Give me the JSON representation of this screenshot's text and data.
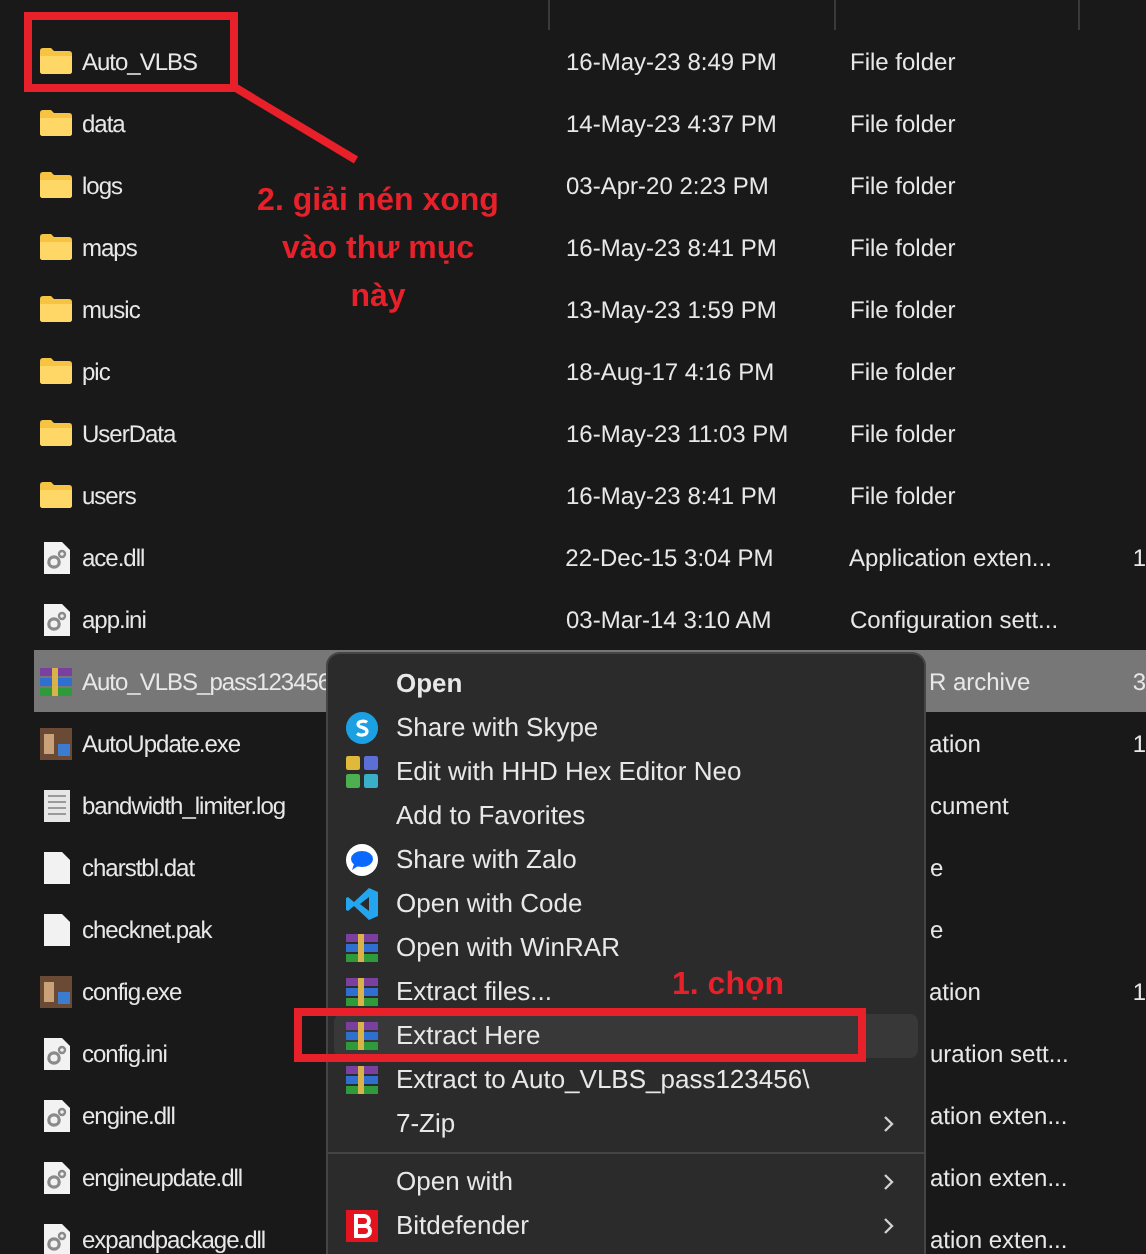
{
  "files": [
    {
      "kind": "folder",
      "name": "Auto_VLBS",
      "date": "16-May-23 8:49 PM",
      "type": "File folder",
      "selected": false
    },
    {
      "kind": "folder",
      "name": "data",
      "date": "14-May-23 4:37 PM",
      "type": "File folder",
      "selected": false
    },
    {
      "kind": "folder",
      "name": "logs",
      "date": "03-Apr-20 2:23 PM",
      "type": "File folder",
      "selected": false
    },
    {
      "kind": "folder",
      "name": "maps",
      "date": "16-May-23 8:41 PM",
      "type": "File folder",
      "selected": false
    },
    {
      "kind": "folder",
      "name": "music",
      "date": "13-May-23 1:59 PM",
      "type": "File folder",
      "selected": false
    },
    {
      "kind": "folder",
      "name": "pic",
      "date": "18-Aug-17 4:16 PM",
      "type": "File folder",
      "selected": false
    },
    {
      "kind": "folder",
      "name": "UserData",
      "date": "16-May-23 11:03 PM",
      "type": "File folder",
      "selected": false
    },
    {
      "kind": "folder",
      "name": "users",
      "date": "16-May-23 8:41 PM",
      "type": "File folder",
      "selected": false
    },
    {
      "kind": "settings",
      "name": "ace.dll",
      "date": "22-Dec-15 3:04 PM",
      "type": "Application exten...",
      "size": "1",
      "selected": false
    },
    {
      "kind": "settings",
      "name": "app.ini",
      "date": "03-Mar-14 3:10 AM",
      "type": "Configuration sett...",
      "selected": false
    },
    {
      "kind": "archive",
      "name": "Auto_VLBS_pass123456",
      "type": "R archive",
      "size": "3",
      "selected": true
    },
    {
      "kind": "program",
      "name": "AutoUpdate.exe",
      "type": "ation",
      "size": "1",
      "selected": false
    },
    {
      "kind": "text",
      "name": "bandwidth_limiter.log",
      "type": "cument",
      "selected": false
    },
    {
      "kind": "blank",
      "name": "charstbl.dat",
      "type": "e",
      "selected": false
    },
    {
      "kind": "blank",
      "name": "checknet.pak",
      "type": "e",
      "selected": false
    },
    {
      "kind": "program",
      "name": "config.exe",
      "type": "ation",
      "size": "1",
      "selected": false
    },
    {
      "kind": "settings",
      "name": "config.ini",
      "type": "uration sett...",
      "selected": false
    },
    {
      "kind": "settings",
      "name": "engine.dll",
      "type": "ation exten...",
      "selected": false
    },
    {
      "kind": "settings",
      "name": "engineupdate.dll",
      "type": "ation exten...",
      "selected": false
    },
    {
      "kind": "settings",
      "name": "expandpackage.dll",
      "type": "ation exten...",
      "selected": false
    }
  ],
  "context_menu": [
    {
      "kind": "plain",
      "label": "Open",
      "bold": true,
      "hovered": false
    },
    {
      "kind": "skype",
      "label": "Share with Skype",
      "hovered": false
    },
    {
      "kind": "hex",
      "label": "Edit with HHD Hex Editor Neo",
      "hovered": false
    },
    {
      "kind": "plain",
      "label": "Add to Favorites",
      "hovered": false
    },
    {
      "kind": "zalo",
      "label": "Share with Zalo",
      "hovered": false
    },
    {
      "kind": "vscode",
      "label": "Open with Code",
      "hovered": false
    },
    {
      "kind": "winrar",
      "label": "Open with WinRAR",
      "hovered": false
    },
    {
      "kind": "winrar",
      "label": "Extract files...",
      "hovered": false
    },
    {
      "kind": "winrar",
      "label": "Extract Here",
      "hovered": true
    },
    {
      "kind": "winrar",
      "label": "Extract to Auto_VLBS_pass123456\\",
      "hovered": false
    },
    {
      "kind": "plain",
      "label": "7-Zip",
      "submenu": true,
      "hovered": false
    },
    {
      "kind": "separator"
    },
    {
      "kind": "plain",
      "label": "Open with",
      "submenu": true,
      "hovered": false
    },
    {
      "kind": "bitdefender",
      "label": "Bitdefender",
      "submenu": true,
      "hovered": false
    }
  ],
  "annotations": [
    {
      "text": "2. giải nén xong vào thư mục này"
    },
    {
      "text": "1. chọn"
    }
  ]
}
